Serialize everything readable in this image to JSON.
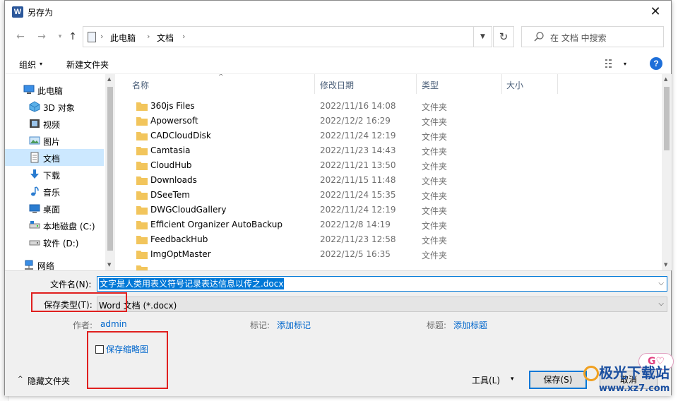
{
  "titlebar": {
    "title": "另存为",
    "app_icon_letter": "W",
    "close_glyph": "✕"
  },
  "nav": {
    "back_glyph": "←",
    "forward_glyph": "→",
    "history_glyph": "▾",
    "up_glyph": "↑",
    "breadcrumb": [
      "此电脑",
      "文档"
    ],
    "chevron": "›",
    "refresh_glyph": "↻",
    "search_placeholder": "在 文档 中搜索"
  },
  "toolbar": {
    "organize": "组织",
    "organize_caret": "▾",
    "new_folder": "新建文件夹",
    "view_caret": "▾",
    "help": "?"
  },
  "sidebar": {
    "items": [
      {
        "label": "此电脑",
        "icon": "computer-icon"
      },
      {
        "label": "3D 对象",
        "icon": "cube-icon"
      },
      {
        "label": "视频",
        "icon": "film-icon"
      },
      {
        "label": "图片",
        "icon": "picture-icon"
      },
      {
        "label": "文档",
        "icon": "document-icon",
        "selected": true
      },
      {
        "label": "下载",
        "icon": "download-icon"
      },
      {
        "label": "音乐",
        "icon": "music-icon"
      },
      {
        "label": "桌面",
        "icon": "desktop-icon"
      },
      {
        "label": "本地磁盘 (C:)",
        "icon": "drive-icon"
      },
      {
        "label": "软件 (D:)",
        "icon": "drive-icon"
      },
      {
        "label": "网络",
        "icon": "network-icon"
      }
    ]
  },
  "filelist": {
    "columns": {
      "name": "名称",
      "date": "修改日期",
      "type": "类型",
      "size": "大小"
    },
    "sort_arrow": "^",
    "rows": [
      {
        "name": "360js Files",
        "date": "2022/11/16 14:08",
        "type": "文件夹"
      },
      {
        "name": "Apowersoft",
        "date": "2022/12/2 16:29",
        "type": "文件夹"
      },
      {
        "name": "CADCloudDisk",
        "date": "2022/11/24 12:19",
        "type": "文件夹"
      },
      {
        "name": "Camtasia",
        "date": "2022/11/23 14:43",
        "type": "文件夹"
      },
      {
        "name": "CloudHub",
        "date": "2022/11/21 13:50",
        "type": "文件夹"
      },
      {
        "name": "Downloads",
        "date": "2022/11/15 11:48",
        "type": "文件夹"
      },
      {
        "name": "DSeeTem",
        "date": "2022/11/24 15:35",
        "type": "文件夹"
      },
      {
        "name": "DWGCloudGallery",
        "date": "2022/11/24 12:19",
        "type": "文件夹"
      },
      {
        "name": "Efficient Organizer AutoBackup",
        "date": "2022/12/8 14:19",
        "type": "文件夹"
      },
      {
        "name": "FeedbackHub",
        "date": "2022/11/23 12:58",
        "type": "文件夹"
      },
      {
        "name": "ImgOptMaster",
        "date": "2022/12/5 16:35",
        "type": "文件夹"
      }
    ]
  },
  "form": {
    "filename_label": "文件名(N):",
    "filename_value": "文字是人类用表义符号记录表达信息以传之.docx",
    "filetype_label": "保存类型(T):",
    "filetype_value": "Word 文档 (*.docx)",
    "author_label": "作者:",
    "author_value": "admin",
    "tags_label": "标记:",
    "tags_value": "添加标记",
    "title_label": "标题:",
    "title_value": "添加标题",
    "thumbnail_label": "保存缩略图",
    "hide_folders": "隐藏文件夹",
    "hide_caret": "^",
    "tools": "工具(L)",
    "tools_caret": "▾",
    "save": "保存(S)",
    "cancel": "取消",
    "dropdown_caret": "⌵"
  },
  "watermark": {
    "line1": "极光下载站",
    "line2": "www.xz7.com",
    "badge": "G♡"
  },
  "colors": {
    "accent": "#0078d7",
    "selected_bg": "#cce8ff",
    "annotation_red": "#e0201f",
    "folder_yellow": "#f2c55c"
  }
}
